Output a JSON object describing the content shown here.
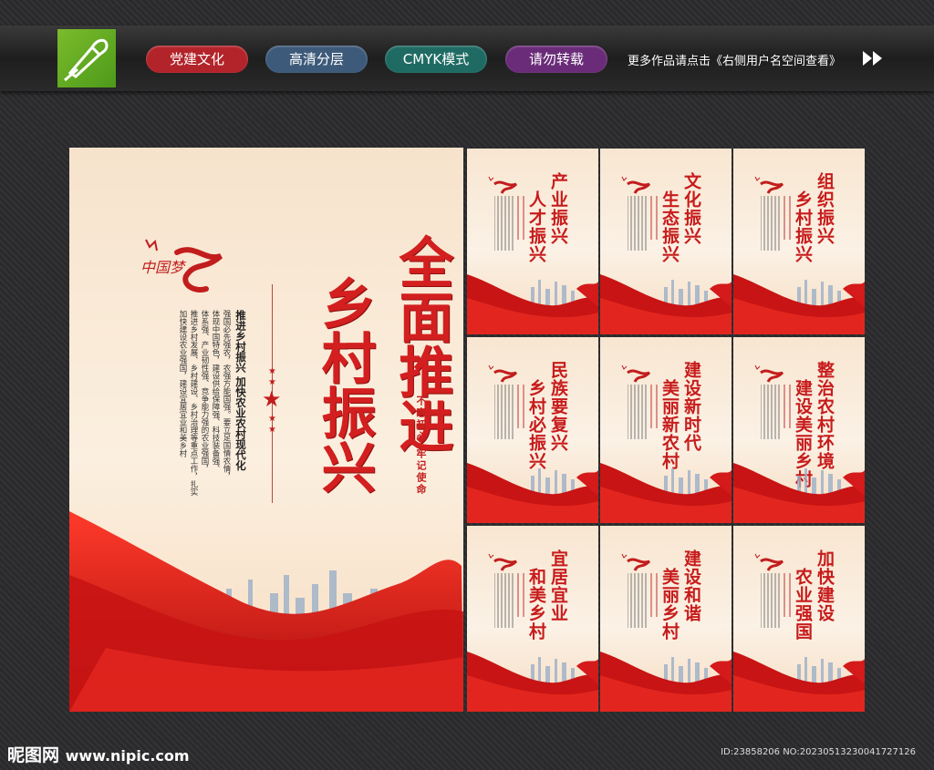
{
  "header": {
    "tags": [
      "党建文化",
      "高清分层",
      "CMYK模式",
      "请勿转载"
    ],
    "more_link": "更多作品请点击《右侧用户名空间查看》"
  },
  "main_poster": {
    "logo_text": "中国梦",
    "title_col_1": "全面推进",
    "title_col_2": "乡村振兴",
    "slogan": "推进乡村振兴 加快农业农村现代化",
    "body_lines": [
      "强国必先强农，农强方能国强。要立足国情农情，",
      "体现中国特色，建设供给保障强、科技装备强、",
      "体系强、产业韧性强、竞争能力强的农业强国，",
      "推进乡村发展、乡村建设、乡村治理等重点工作，扎实",
      "加快建设农业强国，建设宜居宜业和美乡村"
    ],
    "remember": "不忘初心 牢记使命"
  },
  "small_posters": [
    {
      "col1": "产业振兴",
      "col2": "人才振兴"
    },
    {
      "col1": "文化振兴",
      "col2": "生态振兴"
    },
    {
      "col1": "组织振兴",
      "col2": "乡村振兴"
    },
    {
      "col1": "民族要复兴",
      "col2": "乡村必振兴"
    },
    {
      "col1": "建设新时代",
      "col2": "美丽新农村"
    },
    {
      "col1": "整治农村环境",
      "col2": "建设美丽乡村"
    },
    {
      "col1": "宜居宜业",
      "col2": "和美乡村"
    },
    {
      "col1": "建设和谐",
      "col2": "美丽乡村"
    },
    {
      "col1": "加快建设",
      "col2": "农业强国"
    }
  ],
  "footer": {
    "site_name": "昵图网",
    "site_url": "www.nipic.com",
    "id_text": "ID:23858206 NO:20230513230041727126"
  },
  "colors": {
    "red": "#d31f1f",
    "poster_bg": "#fbefdf"
  }
}
